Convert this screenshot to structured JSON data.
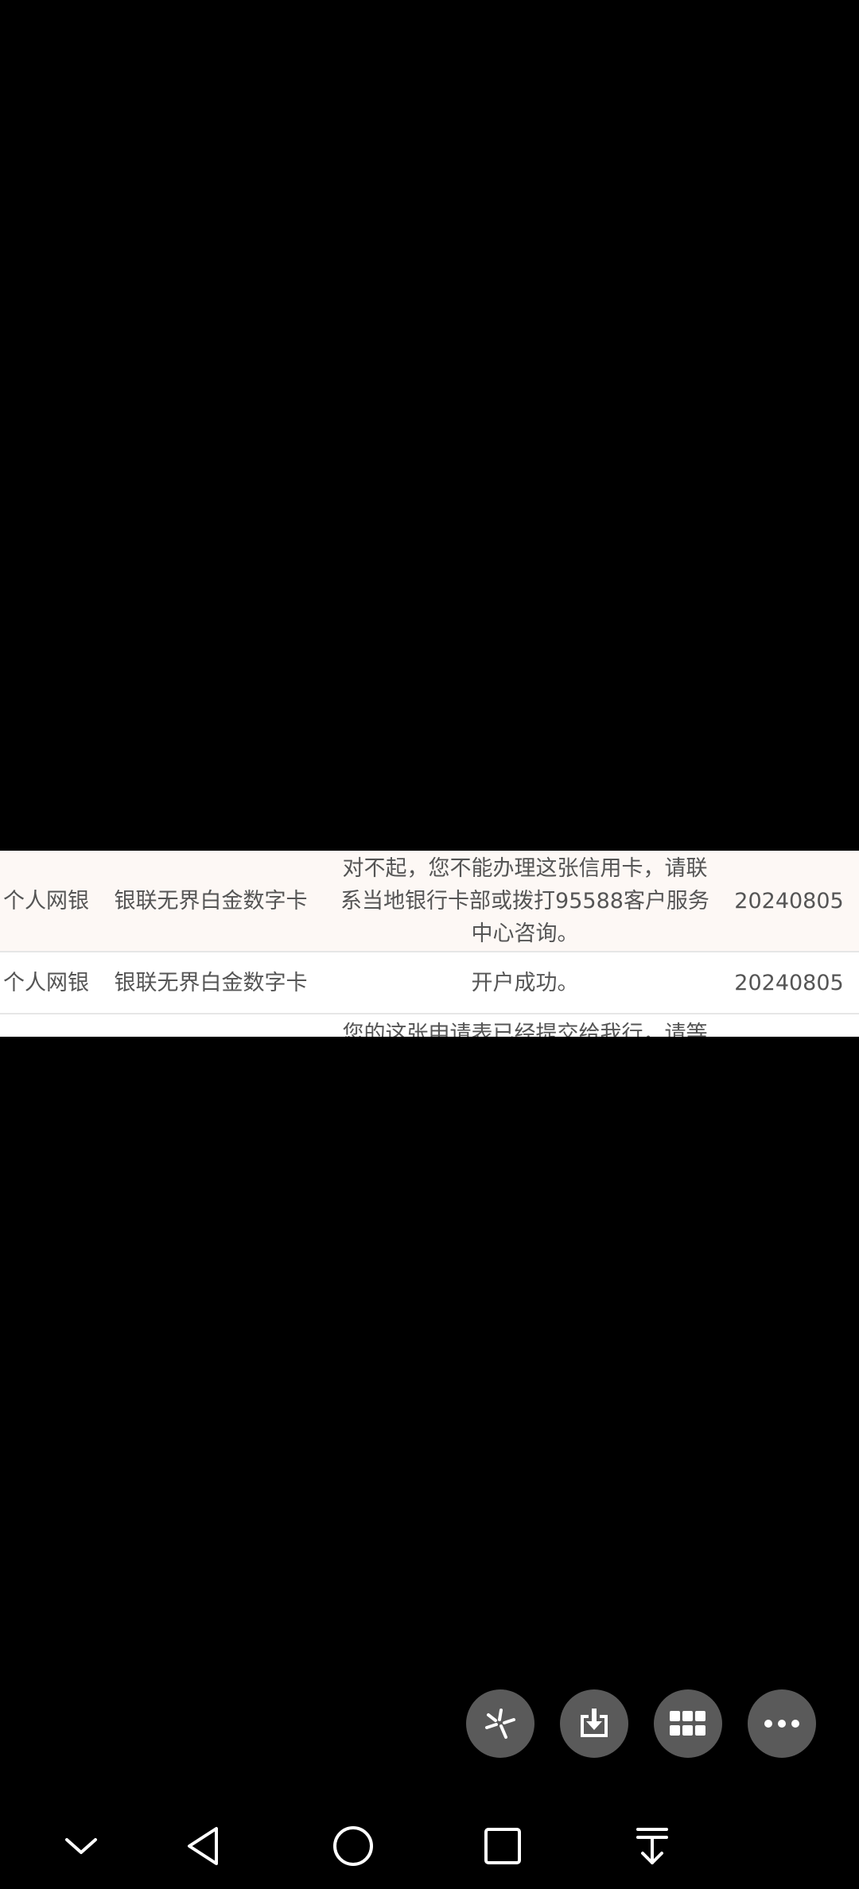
{
  "table": {
    "rows": [
      {
        "channel": "个人网银",
        "card": "银联无界白金数字卡",
        "status": "对不起，您不能办理这张信用卡，请联系当地银行卡部或拨打95588客户服务中心咨询。",
        "date": "20240805"
      },
      {
        "channel": "个人网银",
        "card": "银联无界白金数字卡",
        "status": "开户成功。",
        "date": "20240805"
      },
      {
        "channel": "",
        "card": "",
        "status": "您的这张申请表已经提交给我行，请等待我",
        "date": ""
      }
    ]
  },
  "fabs": [
    {
      "name": "pinwheel-icon"
    },
    {
      "name": "download-icon"
    },
    {
      "name": "grid-icon"
    },
    {
      "name": "more-icon"
    }
  ],
  "navbar": {
    "icons": [
      "chevron-down-icon",
      "back-triangle-icon",
      "home-circle-icon",
      "recents-square-icon",
      "collapse-arrow-icon"
    ]
  },
  "colors": {
    "background": "#000000",
    "row_highlight": "#fdf8f5",
    "text": "#555555",
    "fab": "#5a5a5a"
  }
}
